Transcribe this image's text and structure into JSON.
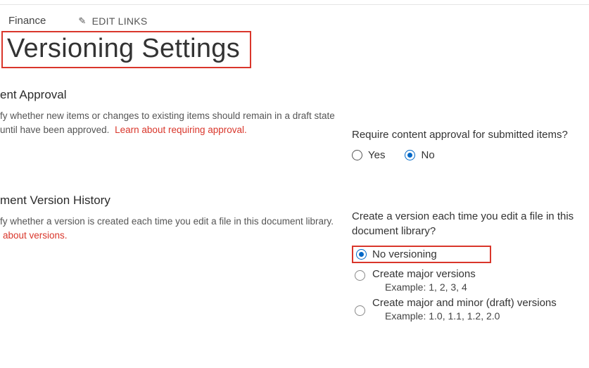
{
  "breadcrumb": {
    "site": "Finance"
  },
  "editLinks": {
    "label": "EDIT LINKS"
  },
  "pageTitle": "Versioning Settings",
  "approval": {
    "heading": "ent Approval",
    "desc": "fy whether new items or changes to existing items should remain in a draft state until have been approved.",
    "helpLink": "Learn about requiring approval.",
    "question": "Require content approval for submitted items?",
    "yes": "Yes",
    "no": "No"
  },
  "version": {
    "heading": "ment Version History",
    "desc": "fy whether a version is created each time you edit a file in this document library.",
    "helpLink": "about versions.",
    "question": "Create a version each time you edit a file in this document library?",
    "opts": {
      "none": "No versioning",
      "major": "Create major versions",
      "majorEx": "Example: 1, 2, 3, 4",
      "minor": "Create major and minor (draft) versions",
      "minorEx": "Example: 1.0, 1.1, 1.2, 2.0"
    }
  }
}
